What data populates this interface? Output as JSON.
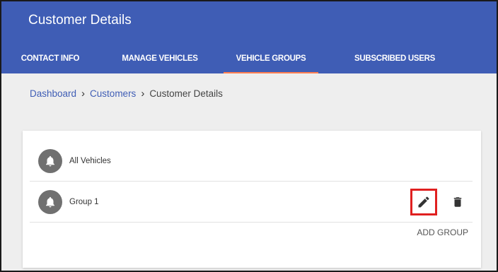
{
  "header": {
    "title": "Customer Details"
  },
  "tabs": [
    {
      "label": "CONTACT INFO"
    },
    {
      "label": "MANAGE VEHICLES"
    },
    {
      "label": "VEHICLE GROUPS",
      "active": true
    },
    {
      "label": "SUBSCRIBED USERS"
    }
  ],
  "breadcrumb": {
    "items": [
      "Dashboard",
      "Customers",
      "Customer Details"
    ],
    "separator": "›"
  },
  "groups": [
    {
      "label": "All Vehicles",
      "icon": "bell-icon"
    },
    {
      "label": "Group 1",
      "icon": "bell-icon",
      "actions": [
        "edit-icon",
        "delete-icon"
      ]
    }
  ],
  "add_group_label": "ADD GROUP",
  "colors": {
    "header": "#3f5db5",
    "active_tab_underline": "#ff7f50",
    "highlight_box": "#e02020",
    "avatar": "#707070"
  }
}
